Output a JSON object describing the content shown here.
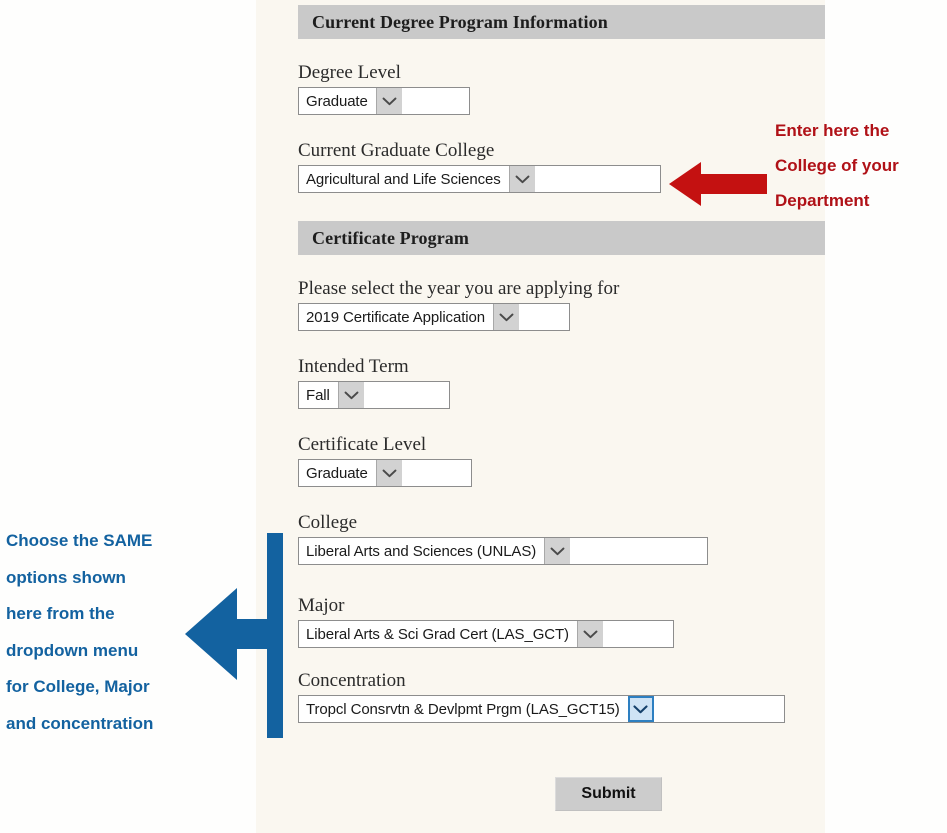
{
  "sections": [
    {
      "id": "degree",
      "title": "Current Degree Program Information"
    },
    {
      "id": "certificate",
      "title": "Certificate Program"
    }
  ],
  "fields": {
    "degree_level": {
      "label": "Degree Level",
      "value": "Graduate"
    },
    "grad_college": {
      "label": "Current Graduate College",
      "value": "Agricultural and Life Sciences"
    },
    "year": {
      "label": "Please select the year you are applying for",
      "value": "2019 Certificate Application"
    },
    "term": {
      "label": "Intended Term",
      "value": "Fall"
    },
    "cert_level": {
      "label": "Certificate Level",
      "value": "Graduate"
    },
    "college": {
      "label": "College",
      "value": "Liberal Arts and Sciences (UNLAS)"
    },
    "major": {
      "label": "Major",
      "value": "Liberal Arts & Sci Grad Cert (LAS_GCT)"
    },
    "concentration": {
      "label": "Concentration",
      "value": "Tropcl Consrvtn & Devlpmt Prgm (LAS_GCT15)"
    }
  },
  "submit": {
    "label": "Submit"
  },
  "annotations": {
    "red": {
      "lines": [
        "Enter here the",
        "College of your",
        "Department"
      ],
      "color": "#b01117",
      "arrow_icon": "left-arrow-icon"
    },
    "blue": {
      "lines": [
        "Choose the SAME",
        "options shown",
        "here from the",
        "dropdown menu",
        "for College, Major",
        "and concentration"
      ],
      "color": "#1362a0",
      "arrow_icon": "left-bracket-arrow-icon"
    }
  },
  "icons": {
    "dropdown": "chevron-down-icon"
  }
}
